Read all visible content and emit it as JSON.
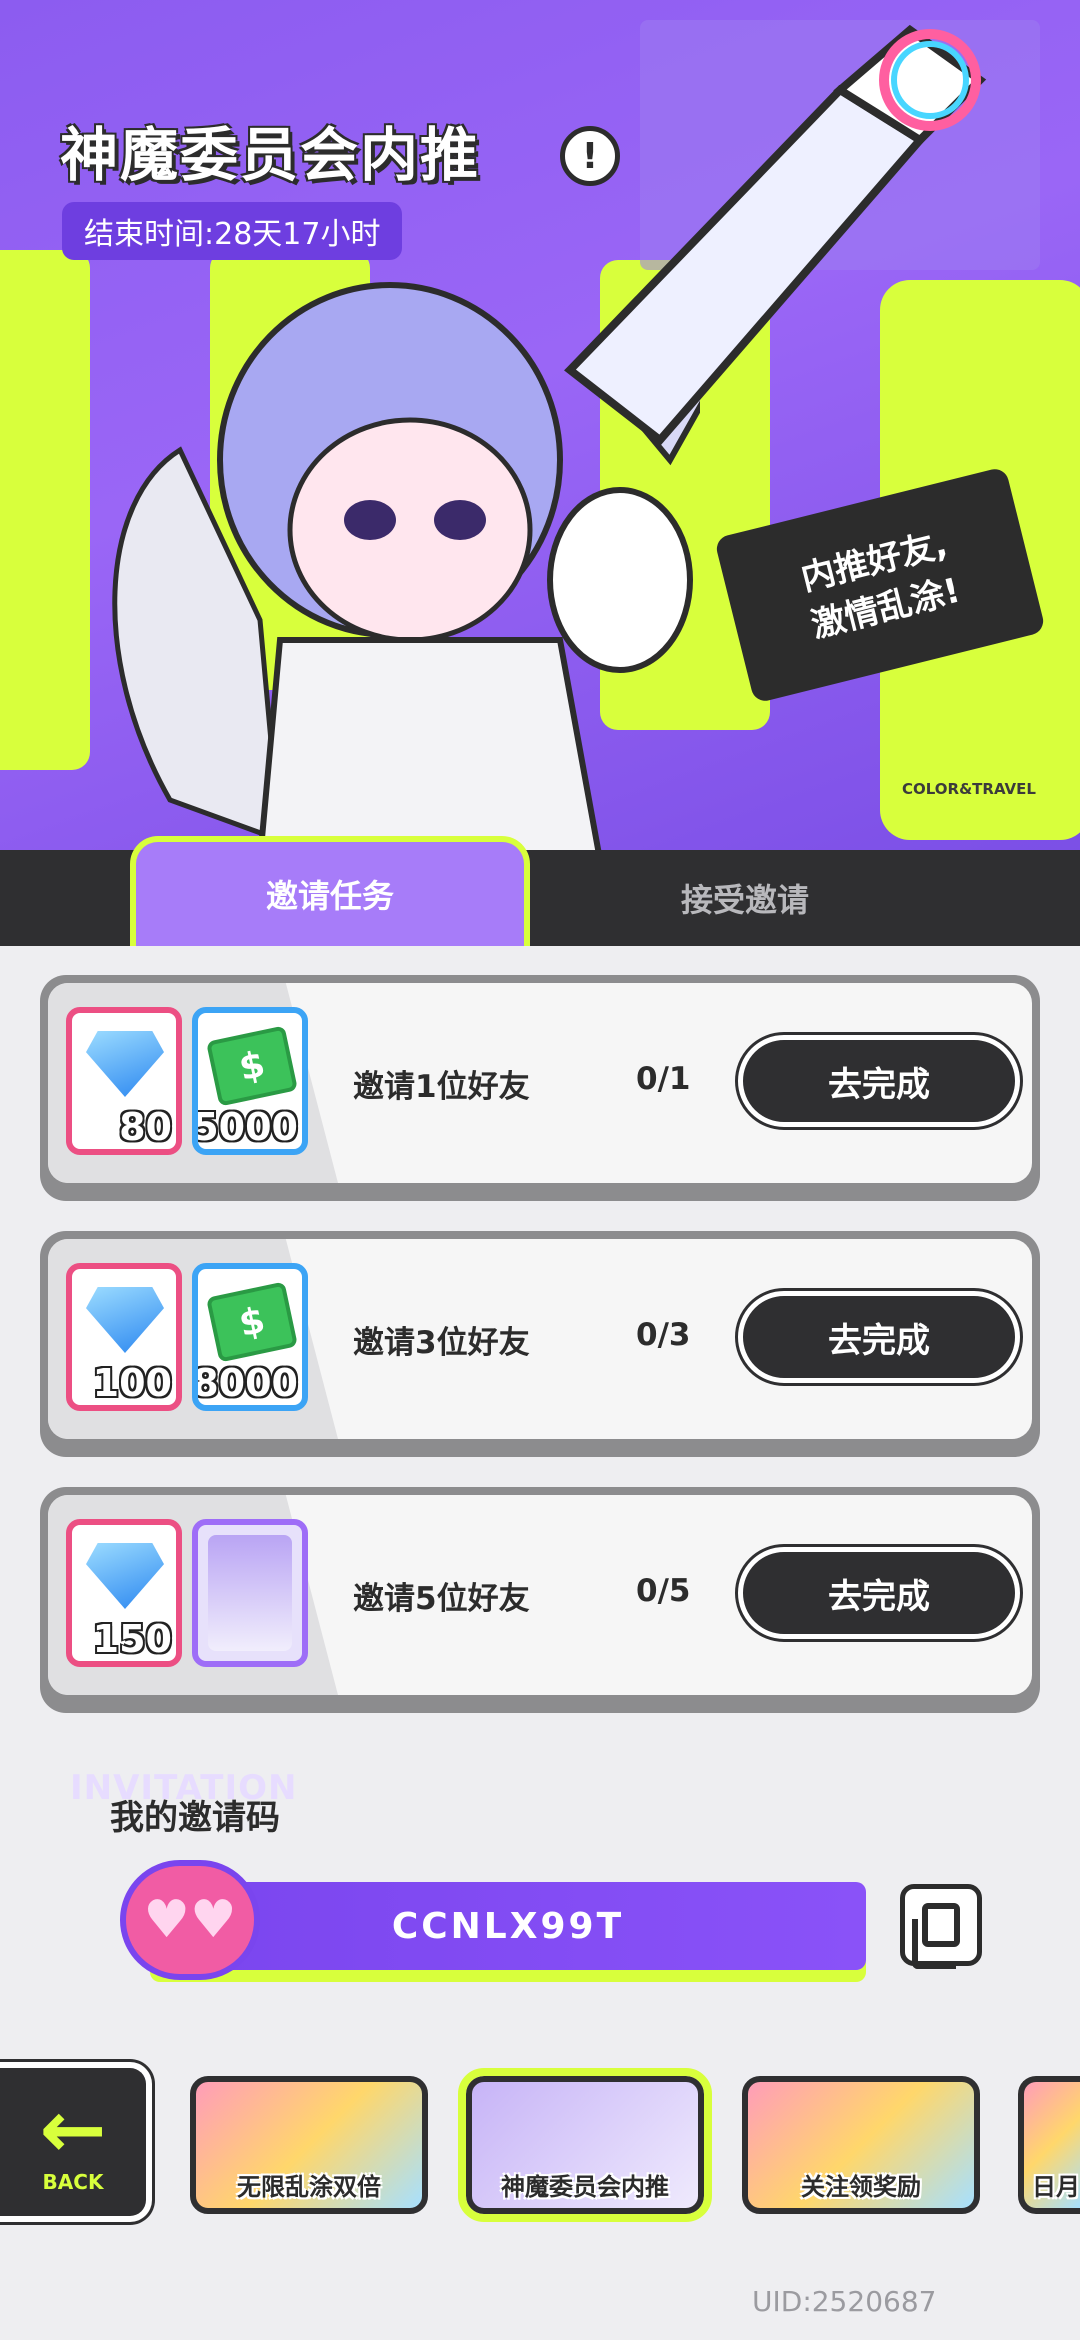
{
  "hero": {
    "title": "神魔委员会内推",
    "end_time": "结束时间:28天17小时",
    "speech_line1": "内推好友,",
    "speech_line2": "激情乱涂!",
    "brand": "COLOR&TRAVEL"
  },
  "tabs": [
    {
      "label": "邀请任务",
      "active": true
    },
    {
      "label": "接受邀请",
      "active": false
    }
  ],
  "tasks": [
    {
      "rewards": [
        {
          "kind": "gem-icon",
          "qty": "80"
        },
        {
          "kind": "cash-icon",
          "qty": "5000"
        }
      ],
      "label": "邀请1位好友",
      "progress": "0/1",
      "button": "去完成"
    },
    {
      "rewards": [
        {
          "kind": "gem-icon",
          "qty": "100"
        },
        {
          "kind": "cash-icon",
          "qty": "8000"
        }
      ],
      "label": "邀请3位好友",
      "progress": "0/3",
      "button": "去完成"
    },
    {
      "rewards": [
        {
          "kind": "gem-icon",
          "qty": "150"
        },
        {
          "kind": "portrait-card-icon",
          "qty": ""
        }
      ],
      "label": "邀请5位好友",
      "progress": "0/5",
      "button": "去完成"
    }
  ],
  "invite": {
    "watermark": "INVITATION",
    "title": "我的邀请码",
    "code": "CCNLX99T"
  },
  "bottom_nav": {
    "back_label": "BACK",
    "items": [
      {
        "label": "无限乱涂双倍",
        "selected": false
      },
      {
        "label": "神魔委员会内推",
        "selected": true
      },
      {
        "label": "关注领奖励",
        "selected": false
      },
      {
        "label": "日月",
        "selected": false
      }
    ]
  },
  "footer": {
    "uid": "UID:2520687"
  },
  "colors": {
    "accent_lime": "#d8ff3c",
    "accent_purple": "#8a52f8",
    "dark": "#2f2f31"
  }
}
